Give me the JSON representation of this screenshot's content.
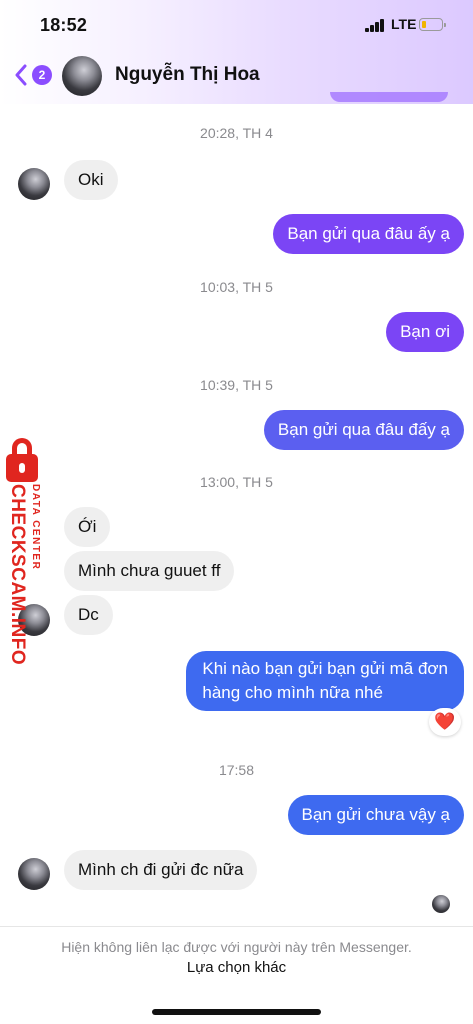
{
  "status_bar": {
    "time": "18:52",
    "network": "LTE",
    "battery_color": "#f0b400"
  },
  "header": {
    "back_badge": "2",
    "contact_name": "Nguyễn Thị Hoa"
  },
  "conversation": {
    "timestamps": [
      "20:28, TH 4",
      "10:03, TH 5",
      "10:39, TH 5",
      "13:00, TH 5",
      "17:58"
    ],
    "messages": [
      {
        "direction": "incoming",
        "text": "Oki"
      },
      {
        "direction": "outgoing",
        "text": "Bạn gửi qua đâu ấy ạ"
      },
      {
        "direction": "outgoing",
        "text": "Bạn ơi"
      },
      {
        "direction": "outgoing",
        "text": "Bạn gửi qua đâu đấy ạ"
      },
      {
        "direction": "incoming",
        "text": "Ới"
      },
      {
        "direction": "incoming",
        "text": "Mình chưa guuet ff"
      },
      {
        "direction": "incoming",
        "text": "Dc"
      },
      {
        "direction": "outgoing",
        "text": "Khi nào bạn gửi bạn gửi mã đơn hàng cho mình nữa nhé",
        "lines": [
          "Khi nào bạn gửi bạn gửi mã đơn",
          "hàng cho mình nữa nhé"
        ],
        "reaction": "❤️"
      },
      {
        "direction": "outgoing",
        "text": "Bạn gửi chưa vậy ạ"
      },
      {
        "direction": "incoming",
        "text": "Mình ch đi gửi đc nữa"
      }
    ]
  },
  "watermark": {
    "top_text": "DATA CENTER",
    "main_text": "CHECKSCAM.INFO",
    "color": "#e0261f"
  },
  "footer": {
    "notice": "Hiện không liên lạc được với người này trên Messenger.",
    "action": "Lựa chọn khác"
  },
  "colors": {
    "accent": "#8b4dff",
    "outgoing_purple": "#7b45f5",
    "outgoing_blue": "#3e6af0",
    "incoming_bg": "#efefef"
  }
}
